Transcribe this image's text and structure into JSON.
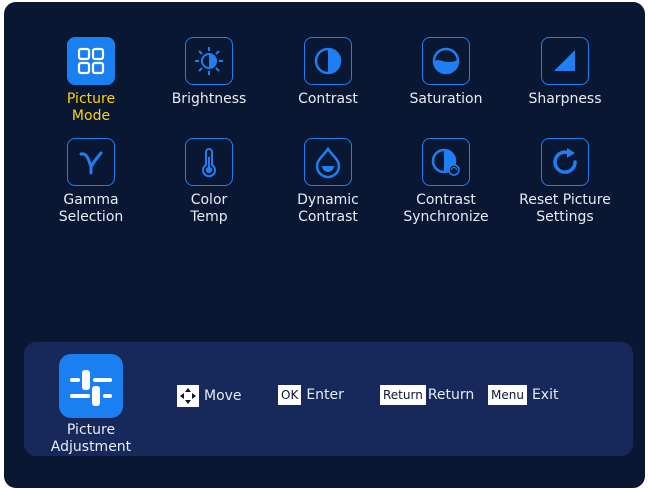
{
  "menu": {
    "items": [
      {
        "label": "Picture\nMode",
        "icon": "grid-icon",
        "selected": true
      },
      {
        "label": "Brightness",
        "icon": "sun-icon",
        "selected": false
      },
      {
        "label": "Contrast",
        "icon": "contrast-icon",
        "selected": false
      },
      {
        "label": "Saturation",
        "icon": "saturation-icon",
        "selected": false
      },
      {
        "label": "Sharpness",
        "icon": "sharpness-icon",
        "selected": false
      },
      {
        "label": "Gamma\nSelection",
        "icon": "gamma-icon",
        "selected": false
      },
      {
        "label": "Color\nTemp",
        "icon": "thermometer-icon",
        "selected": false
      },
      {
        "label": "Dynamic\nContrast",
        "icon": "droplet-icon",
        "selected": false
      },
      {
        "label": "Contrast\nSynchronize",
        "icon": "contrast-sync-icon",
        "selected": false
      },
      {
        "label": "Reset Picture\nSettings",
        "icon": "reset-icon",
        "selected": false
      }
    ]
  },
  "footer": {
    "section_label": "Picture\nAdjustment",
    "section_icon": "sliders-icon",
    "hints": [
      {
        "key": "",
        "key_icon": "dpad-icon",
        "label": "Move"
      },
      {
        "key": "OK",
        "label": "Enter"
      },
      {
        "key": "Return",
        "label": "Return"
      },
      {
        "key": "Menu",
        "label": "Exit"
      }
    ]
  },
  "colors": {
    "background": "#0a1733",
    "panel": "#16295a",
    "accent": "#1a7ff0",
    "selected_text": "#ffd400",
    "text": "#e6ecf5"
  }
}
